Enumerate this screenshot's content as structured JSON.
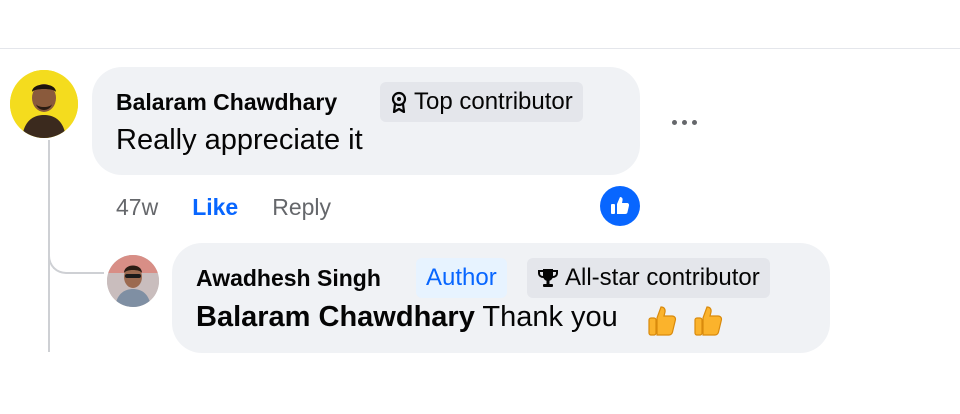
{
  "comment": {
    "author": "Balaram Chawdhary",
    "badge": "Top contributor",
    "badge_icon": "medal-icon",
    "text": "Really appreciate it",
    "time": "47w",
    "like_label": "Like",
    "reply_label": "Reply",
    "reaction_icon": "thumbs-up-reaction-icon"
  },
  "reply": {
    "author": "Awadhesh Singh",
    "author_label": "Author",
    "badge": "All-star contributor",
    "badge_icon": "trophy-icon",
    "mention": "Balaram Chawdhary",
    "text": " Thank you "
  },
  "colors": {
    "accent": "#0866ff",
    "bubble": "#f0f2f5",
    "muted": "#65676b"
  }
}
